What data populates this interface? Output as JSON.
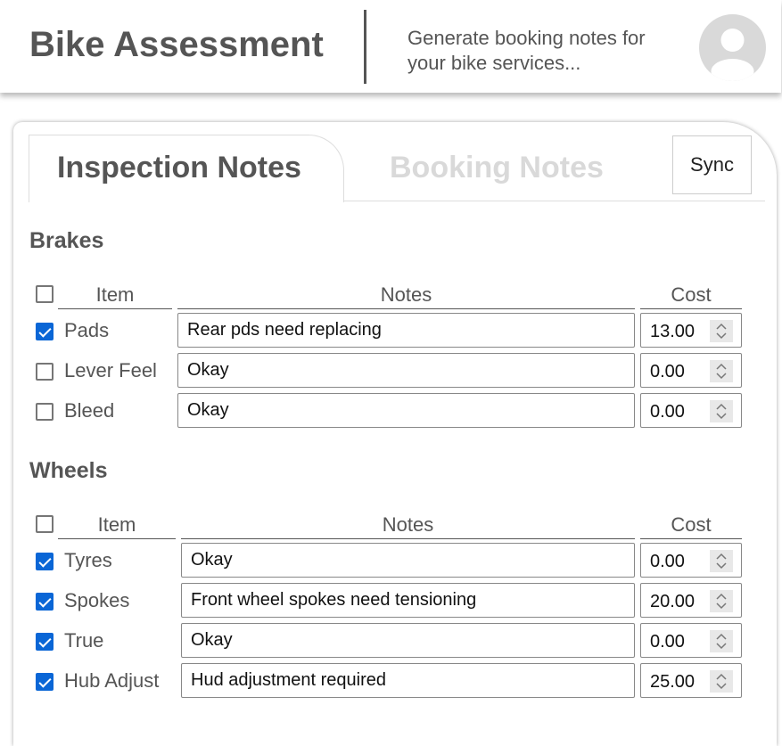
{
  "header": {
    "title": "Bike Assessment",
    "subtitle": "Generate booking notes for your bike services..."
  },
  "icons": {
    "avatar": "user-avatar-icon",
    "spinner": "number-spinner-icon"
  },
  "colors": {
    "text": "#555555",
    "accent": "#0a66d6",
    "inactive_tab": "#d9d9d9",
    "avatar_bg": "#d9d9d9"
  },
  "tabs": {
    "active": "Inspection Notes",
    "inactive": "Booking Notes",
    "sync": "Sync"
  },
  "sections": [
    {
      "title": "Brakes",
      "header": {
        "all_checked": false,
        "item": "Item",
        "notes": "Notes",
        "cost": "Cost"
      },
      "rows": [
        {
          "checked": true,
          "item": "Pads",
          "notes": "Rear pds need replacing",
          "cost": "13.00"
        },
        {
          "checked": false,
          "item": "Lever Feel",
          "notes": "Okay",
          "cost": "0.00"
        },
        {
          "checked": false,
          "item": "Bleed",
          "notes": "Okay",
          "cost": "0.00"
        }
      ]
    },
    {
      "title": "Wheels",
      "header": {
        "all_checked": false,
        "item": "Item",
        "notes": "Notes",
        "cost": "Cost"
      },
      "rows": [
        {
          "checked": true,
          "item": "Tyres",
          "notes": "Okay",
          "cost": "0.00"
        },
        {
          "checked": true,
          "item": "Spokes",
          "notes": "Front wheel spokes need tensioning",
          "cost": "20.00"
        },
        {
          "checked": true,
          "item": "True",
          "notes": "Okay",
          "cost": "0.00"
        },
        {
          "checked": true,
          "item": "Hub Adjust",
          "notes": "Hud adjustment required",
          "cost": "25.00"
        }
      ]
    }
  ]
}
